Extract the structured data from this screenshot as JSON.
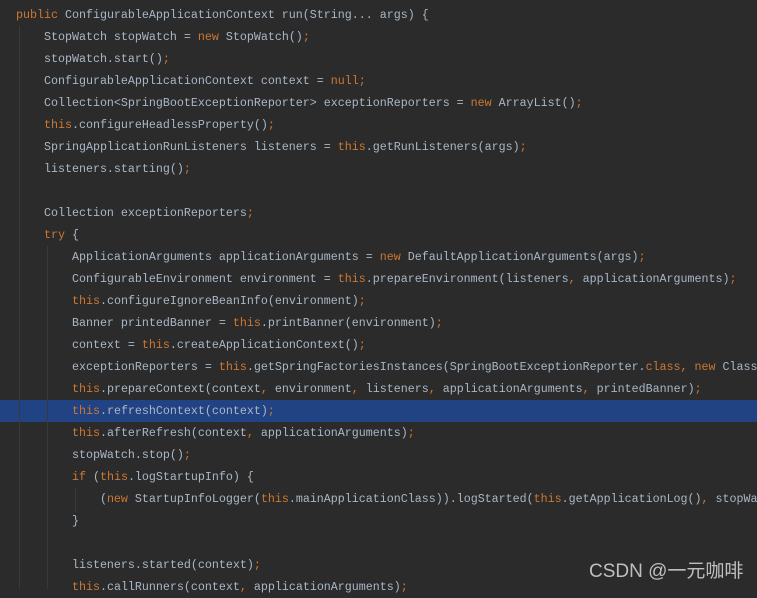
{
  "theme": {
    "background": "#2b2b2b",
    "text": "#a9b7c6",
    "keyword": "#cc7832",
    "current_line": "#214283"
  },
  "highlighted_line": 18,
  "code_lines": [
    [
      [
        "kw",
        "public "
      ],
      [
        "t",
        "ConfigurableApplicationContext run(String... args) {"
      ]
    ],
    [
      [
        "t",
        "    StopWatch stopWatch = "
      ],
      [
        "kw",
        "new "
      ],
      [
        "t",
        "StopWatch()"
      ],
      [
        "kw",
        ";"
      ]
    ],
    [
      [
        "t",
        "    stopWatch.start()"
      ],
      [
        "kw",
        ";"
      ]
    ],
    [
      [
        "t",
        "    ConfigurableApplicationContext context = "
      ],
      [
        "kw",
        "null;"
      ]
    ],
    [
      [
        "t",
        "    Collection<SpringBootExceptionReporter> exceptionReporters = "
      ],
      [
        "kw",
        "new "
      ],
      [
        "t",
        "ArrayList()"
      ],
      [
        "kw",
        ";"
      ]
    ],
    [
      [
        "kw",
        "    this"
      ],
      [
        "t",
        ".configureHeadlessProperty()"
      ],
      [
        "kw",
        ";"
      ]
    ],
    [
      [
        "t",
        "    SpringApplicationRunListeners listeners = "
      ],
      [
        "kw",
        "this"
      ],
      [
        "t",
        ".getRunListeners(args)"
      ],
      [
        "kw",
        ";"
      ]
    ],
    [
      [
        "t",
        "    listeners.starting()"
      ],
      [
        "kw",
        ";"
      ]
    ],
    [],
    [
      [
        "t",
        "    Collection exceptionReporters"
      ],
      [
        "kw",
        ";"
      ]
    ],
    [
      [
        "kw",
        "    try "
      ],
      [
        "t",
        "{"
      ]
    ],
    [
      [
        "t",
        "        ApplicationArguments applicationArguments = "
      ],
      [
        "kw",
        "new "
      ],
      [
        "t",
        "DefaultApplicationArguments(args)"
      ],
      [
        "kw",
        ";"
      ]
    ],
    [
      [
        "t",
        "        ConfigurableEnvironment environment = "
      ],
      [
        "kw",
        "this"
      ],
      [
        "t",
        ".prepareEnvironment(listeners"
      ],
      [
        "kw",
        ", "
      ],
      [
        "t",
        "applicationArguments)"
      ],
      [
        "kw",
        ";"
      ]
    ],
    [
      [
        "kw",
        "        this"
      ],
      [
        "t",
        ".configureIgnoreBeanInfo(environment)"
      ],
      [
        "kw",
        ";"
      ]
    ],
    [
      [
        "t",
        "        Banner printedBanner = "
      ],
      [
        "kw",
        "this"
      ],
      [
        "t",
        ".printBanner(environment)"
      ],
      [
        "kw",
        ";"
      ]
    ],
    [
      [
        "t",
        "        context = "
      ],
      [
        "kw",
        "this"
      ],
      [
        "t",
        ".createApplicationContext()"
      ],
      [
        "kw",
        ";"
      ]
    ],
    [
      [
        "t",
        "        exceptionReporters = "
      ],
      [
        "kw",
        "this"
      ],
      [
        "t",
        ".getSpringFactoriesInstances(SpringBootExceptionReporter."
      ],
      [
        "kw",
        "class, new "
      ],
      [
        "t",
        "Class"
      ]
    ],
    [
      [
        "kw",
        "        this"
      ],
      [
        "t",
        ".prepareContext(context"
      ],
      [
        "kw",
        ", "
      ],
      [
        "t",
        "environment"
      ],
      [
        "kw",
        ", "
      ],
      [
        "t",
        "listeners"
      ],
      [
        "kw",
        ", "
      ],
      [
        "t",
        "applicationArguments"
      ],
      [
        "kw",
        ", "
      ],
      [
        "t",
        "printedBanner)"
      ],
      [
        "kw",
        ";"
      ]
    ],
    [
      [
        "kw",
        "        this"
      ],
      [
        "t",
        ".refreshContext(context)"
      ],
      [
        "kw",
        ";"
      ]
    ],
    [
      [
        "kw",
        "        this"
      ],
      [
        "t",
        ".afterRefresh(context"
      ],
      [
        "kw",
        ", "
      ],
      [
        "t",
        "applicationArguments)"
      ],
      [
        "kw",
        ";"
      ]
    ],
    [
      [
        "t",
        "        stopWatch.stop()"
      ],
      [
        "kw",
        ";"
      ]
    ],
    [
      [
        "kw",
        "        if "
      ],
      [
        "t",
        "("
      ],
      [
        "kw",
        "this"
      ],
      [
        "t",
        ".logStartupInfo) {"
      ]
    ],
    [
      [
        "t",
        "            ("
      ],
      [
        "kw",
        "new "
      ],
      [
        "t",
        "StartupInfoLogger("
      ],
      [
        "kw",
        "this"
      ],
      [
        "t",
        ".mainApplicationClass)).logStarted("
      ],
      [
        "kw",
        "this"
      ],
      [
        "t",
        ".getApplicationLog()"
      ],
      [
        "kw",
        ", "
      ],
      [
        "t",
        "stopWa"
      ]
    ],
    [
      [
        "t",
        "        }"
      ]
    ],
    [],
    [
      [
        "t",
        "        listeners.started(context)"
      ],
      [
        "kw",
        ";"
      ]
    ],
    [
      [
        "kw",
        "        this"
      ],
      [
        "t",
        ".callRunners(context"
      ],
      [
        "kw",
        ", "
      ],
      [
        "t",
        "applicationArguments)"
      ],
      [
        "kw",
        ";"
      ]
    ]
  ],
  "watermark": "CSDN @一元咖啡"
}
